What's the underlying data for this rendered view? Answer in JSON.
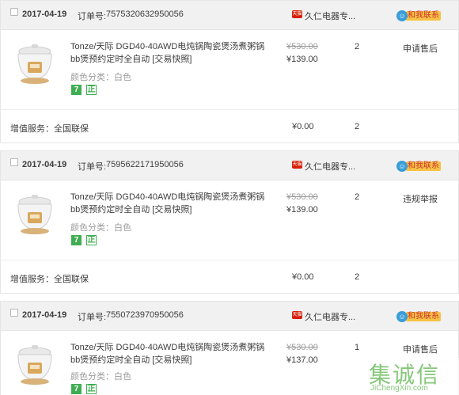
{
  "orders": [
    {
      "date": "2017-04-19",
      "order_no_label": "订单号:",
      "order_no": "7575320632950056",
      "shop_badge": "天猫",
      "shop_name": "久仁电器专...",
      "contact_label": "和我联系",
      "item_title": "Tonze/天际 DGD40-40AWD电炖锅陶瓷煲汤煮粥锅bb煲预约定时全自动 [交易快照]",
      "item_spec": "颜色分类：白色",
      "tag_seven": "7",
      "tag_zheng": "正",
      "old_price": "¥530.00",
      "price": "¥139.00",
      "qty": "2",
      "action": "申请售后",
      "service_label": "增值服务：全国联保",
      "service_price": "¥0.00",
      "service_qty": "2"
    },
    {
      "date": "2017-04-19",
      "order_no_label": "订单号:",
      "order_no": "7595622171950056",
      "shop_badge": "天猫",
      "shop_name": "久仁电器专...",
      "contact_label": "和我联系",
      "item_title": "Tonze/天际 DGD40-40AWD电炖锅陶瓷煲汤煮粥锅bb煲预约定时全自动 [交易快照]",
      "item_spec": "颜色分类：白色",
      "tag_seven": "7",
      "tag_zheng": "正",
      "old_price": "¥530.00",
      "price": "¥139.00",
      "qty": "2",
      "action": "违规举报",
      "service_label": "增值服务：全国联保",
      "service_price": "¥0.00",
      "service_qty": "2"
    },
    {
      "date": "2017-04-19",
      "order_no_label": "订单号:",
      "order_no": "7550723970950056",
      "shop_badge": "天猫",
      "shop_name": "久仁电器专...",
      "contact_label": "和我联系",
      "item_title": "Tonze/天际 DGD40-40AWD电炖锅陶瓷煲汤煮粥锅bb煲预约定时全自动 [交易快照]",
      "item_spec": "颜色分类：白色",
      "tag_seven": "7",
      "tag_zheng": "正",
      "old_price": "¥530.00",
      "price": "¥137.00",
      "qty": "1",
      "action": "申请售后"
    }
  ],
  "watermark": {
    "chars": "集诚信",
    "url": "JiChengXin.com"
  },
  "colors": {
    "header_bg": "#f1f1f1",
    "tmall_red": "#d81e06",
    "contact_yellow": "#f7c244",
    "tag_green": "#3fae52"
  }
}
